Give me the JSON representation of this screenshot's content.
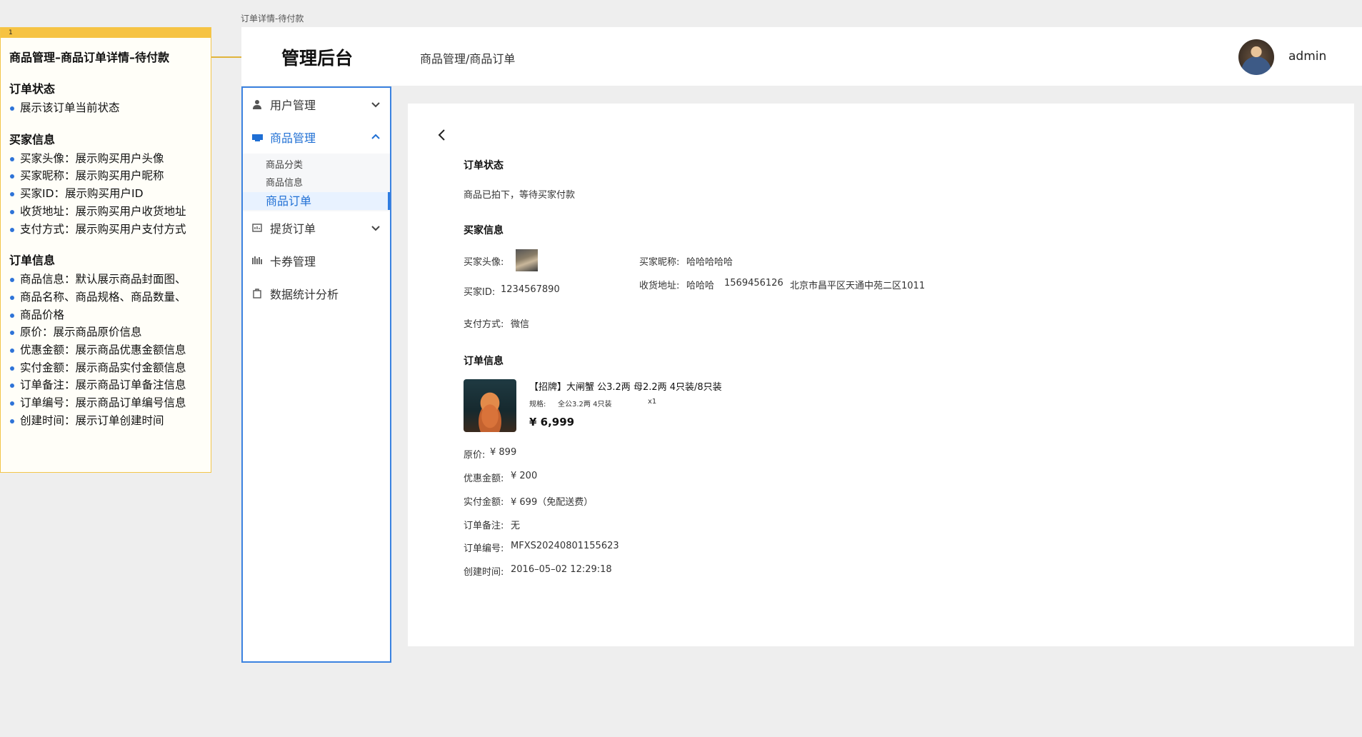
{
  "page_caption": "订单详情-待付款",
  "annotation": {
    "badge": "1",
    "title": "商品管理–商品订单详情–待付款",
    "sections": [
      {
        "heading": "订单状态",
        "items": [
          "展示该订单当前状态"
        ]
      },
      {
        "heading": "买家信息",
        "items": [
          "买家头像：展示购买用户头像",
          "买家昵称：展示购买用户昵称",
          "买家ID：展示购买用户ID",
          "收货地址：展示购买用户收货地址",
          "支付方式：展示购买用户支付方式"
        ]
      },
      {
        "heading": "订单信息",
        "items": [
          "商品信息：默认展示商品封面图、",
          "商品名称、商品规格、商品数量、",
          "商品价格",
          "原价：展示商品原价信息",
          "优惠金额：展示商品优惠金额信息",
          "实付金额：展示商品实付金额信息",
          "订单备注：展示商品订单备注信息",
          "订单编号：展示商品订单编号信息",
          "创建时间：展示订单创建时间"
        ]
      }
    ]
  },
  "header": {
    "brand": "管理后台",
    "breadcrumb": "商品管理/商品订单",
    "user_name": "admin"
  },
  "sidebar": {
    "items": [
      {
        "label": "用户管理",
        "icon": "user-icon",
        "expandable": true
      },
      {
        "label": "商品管理",
        "icon": "goods-icon",
        "expandable": true,
        "active": true,
        "children": [
          "商品分类",
          "商品信息",
          "商品订单"
        ],
        "active_child": "商品订单"
      },
      {
        "label": "提货订单",
        "icon": "pickup-icon",
        "expandable": true
      },
      {
        "label": "卡券管理",
        "icon": "coupon-icon"
      },
      {
        "label": "数据统计分析",
        "icon": "stats-icon"
      }
    ]
  },
  "content": {
    "order_status": {
      "heading": "订单状态",
      "text": "商品已拍下，等待买家付款"
    },
    "buyer": {
      "heading": "买家信息",
      "avatar_label": "买家头像:",
      "nickname_label": "买家昵称:",
      "nickname": "哈哈哈哈哈",
      "id_label": "买家ID:",
      "id": "1234567890",
      "address_label": "收货地址:",
      "address_name": "哈哈哈",
      "address_phone": "1569456126",
      "address_detail": "北京市昌平区天通中苑二区1011",
      "payment_label": "支付方式:",
      "payment": "微信"
    },
    "order": {
      "heading": "订单信息",
      "product_name": "【招牌】大闸蟹 公3.2两 母2.2两  4只装/8只装",
      "spec_label": "规格:",
      "spec_value": "全公3.2两 4只装",
      "quantity": "x1",
      "price": "¥ 6,999",
      "fields": [
        {
          "label": "原价:",
          "value": "¥ 899"
        },
        {
          "label": "优惠金额:",
          "value": "¥ 200"
        },
        {
          "label": "实付金额:",
          "value": "¥ 699（免配送费）"
        },
        {
          "label": "订单备注:",
          "value": "无"
        },
        {
          "label": "订单编号:",
          "value": "MFXS20240801155623"
        },
        {
          "label": "创建时间:",
          "value": "2016–05–02 12:29:18"
        }
      ]
    }
  },
  "colors": {
    "accent": "#1f6fd4",
    "annotation_bar": "#f6c343",
    "sidebar_border": "#3b82e0"
  }
}
